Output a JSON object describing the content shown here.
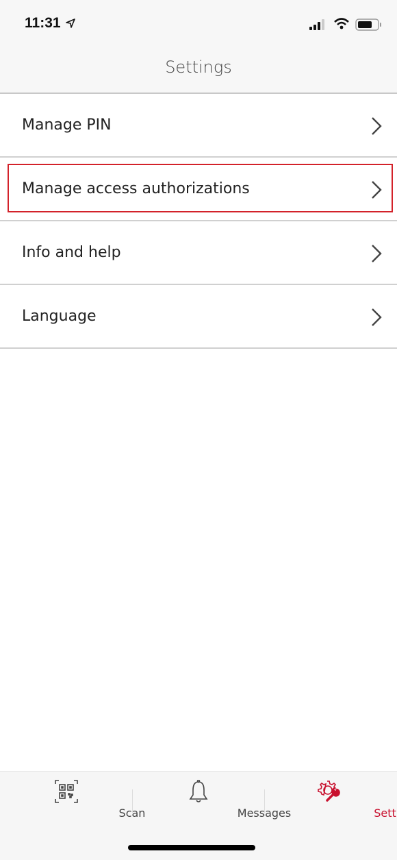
{
  "status_bar": {
    "time": "11:31",
    "icons": [
      "location-arrow-icon",
      "signal-icon",
      "wifi-icon",
      "battery-icon"
    ]
  },
  "nav": {
    "title": "Settings"
  },
  "menu": {
    "items": [
      {
        "label": "Manage PIN",
        "icon": "chevron-right-icon"
      },
      {
        "label": "Manage access authorizations",
        "icon": "chevron-right-icon",
        "highlighted": true
      },
      {
        "label": "Info and help",
        "icon": "chevron-right-icon"
      },
      {
        "label": "Language",
        "icon": "chevron-right-icon"
      }
    ]
  },
  "tabbar": {
    "tabs": [
      {
        "label": "Scan",
        "icon": "qr-code-icon"
      },
      {
        "label": "Messages",
        "icon": "bell-icon"
      },
      {
        "label": "Settings",
        "icon": "gear-wrench-icon",
        "active": true
      }
    ]
  },
  "colors": {
    "accent": "#c8102e",
    "highlight_border": "#d3222a"
  }
}
